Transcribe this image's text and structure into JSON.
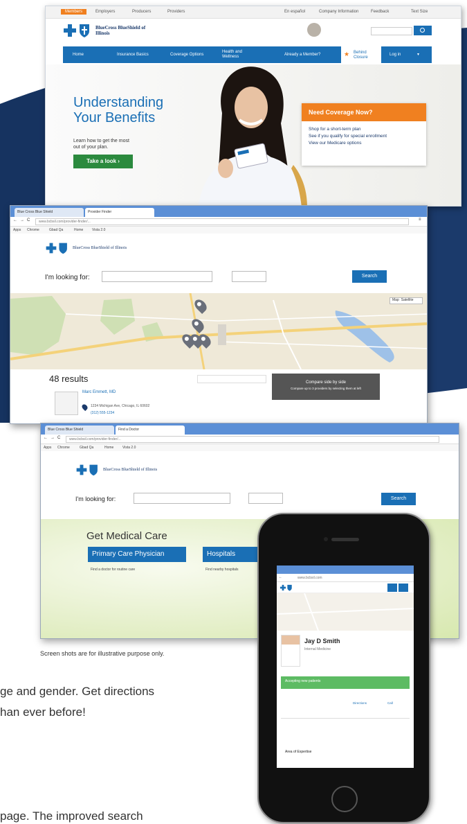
{
  "site": {
    "brand": "BlueCross BlueShield of Illinois",
    "top_tabs": [
      "Members",
      "Employers",
      "Producers",
      "Providers"
    ],
    "top_links": [
      "En español",
      "Company Information",
      "Feedback",
      "Text Size"
    ],
    "login_label": "Log in",
    "nav_items": [
      "Home",
      "Insurance Basics",
      "Coverage Options",
      "Health and Wellness",
      "Already a Member?",
      "Behind Closure"
    ],
    "hero": {
      "title_line1": "Understanding",
      "title_line2": "Your Benefits",
      "sub": "Learn how to get the most out of your plan.",
      "cta": "Take a look"
    },
    "coverage": {
      "title": "Need Coverage Now?",
      "items": [
        "Shop for a short-term plan",
        "See if you qualify for special enrollment",
        "View our Medicare options"
      ]
    }
  },
  "browser1": {
    "tabs": [
      "Blue Cross Blue Shield",
      "Provider Finder"
    ],
    "url": "www.bcbsil.com/provider-finder/...",
    "bookmarks": [
      "Apps",
      "Chrome",
      "Gbad Qa",
      "Home",
      "Vista 2.0"
    ],
    "looking_label": "I'm looking for:",
    "search_label": "Search",
    "results": "48 results",
    "provider_name": "Marc Emmett, MD",
    "provider_addr": "1234 Michigan Ave, Chicago, IL 60602",
    "provider_phone": "(312) 555-1234",
    "compare_label": "Compare side by side",
    "compare_sub": "Compare up to 3 providers by selecting them at left",
    "zoom_labels": [
      "Map",
      "Satellite"
    ]
  },
  "browser2": {
    "tabs": [
      "Blue Cross Blue Shield",
      "Find a Doctor"
    ],
    "url": "www.bcbsil.com/provider-finder/...",
    "bookmarks": [
      "Apps",
      "Chrome",
      "Gbad Qa",
      "Home",
      "Vista 2.0"
    ],
    "looking_label": "I'm looking for:",
    "search_label": "Search",
    "section_title": "Get Medical Care",
    "cards": [
      "Primary Care Physician",
      "Hospitals"
    ],
    "card_sub": [
      "Find a doctor for routine care",
      "Find nearby hospitals"
    ]
  },
  "phone": {
    "url": "www.bcbsil.com",
    "doctor_name": "Jay D Smith",
    "doctor_title": "Internal Medicine",
    "green_bar": "Accepting new patients",
    "section_label": "Area of Expertise",
    "btn_labels": [
      "Directions",
      "Call"
    ]
  },
  "caption": "Screen shots are for illustrative purpose only.",
  "body_lines": [
    "ge and gender. Get directions",
    "han ever before!",
    "page. The improved search"
  ],
  "colors": {
    "brand_blue": "#1a6fb5",
    "dark_navy": "#1b3a6b",
    "orange": "#f08020",
    "green": "#2b8a3e",
    "map_bg": "#efe9d8"
  }
}
